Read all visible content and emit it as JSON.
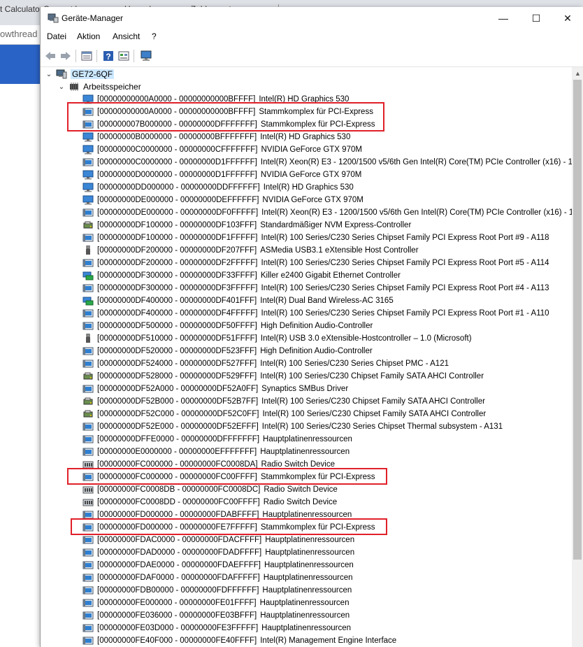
{
  "background": {
    "tabs": [
      "t Calculator",
      "Convert h",
      "Umrechnung von Zahlensyste"
    ],
    "url_fragment": "owthread"
  },
  "window": {
    "title": "Geräte-Manager",
    "controls": {
      "minimize": "—",
      "maximize": "☐",
      "close": "✕"
    }
  },
  "menu": [
    "Datei",
    "Aktion",
    "Ansicht",
    "?"
  ],
  "toolbar": [
    "back-icon",
    "forward-icon",
    "properties-icon",
    "help-icon",
    "show-icon",
    "monitor-icon"
  ],
  "tree": {
    "root": "GE72-6QF",
    "category": "Arbeitsspeicher",
    "items": [
      {
        "range": "[00000000000A0000 - 00000000000BFFFF]",
        "device": "Intel(R) HD Graphics 530",
        "icon": "display"
      },
      {
        "range": "[00000000000A0000 - 00000000000BFFFF]",
        "device": "Stammkomplex für PCI-Express",
        "icon": "device"
      },
      {
        "range": "[000000007B000000 - 00000000DFFFFFFF]",
        "device": "Stammkomplex für PCI-Express",
        "icon": "device"
      },
      {
        "range": "[00000000B0000000 - 00000000BFFFFFFF]",
        "device": "Intel(R) HD Graphics 530",
        "icon": "display"
      },
      {
        "range": "[00000000C0000000 - 00000000CFFFFFFF]",
        "device": "NVIDIA GeForce GTX 970M",
        "icon": "display"
      },
      {
        "range": "[00000000C0000000 - 00000000D1FFFFFF]",
        "device": "Intel(R) Xeon(R) E3 - 1200/1500 v5/6th Gen Intel(R) Core(TM) PCIe Controller (x16) - 190",
        "icon": "device"
      },
      {
        "range": "[00000000D0000000 - 00000000D1FFFFFF]",
        "device": "NVIDIA GeForce GTX 970M",
        "icon": "display"
      },
      {
        "range": "[00000000DD000000 - 00000000DDFFFFFF]",
        "device": "Intel(R) HD Graphics 530",
        "icon": "display"
      },
      {
        "range": "[00000000DE000000 - 00000000DEFFFFFF]",
        "device": "NVIDIA GeForce GTX 970M",
        "icon": "display"
      },
      {
        "range": "[00000000DE000000 - 00000000DF0FFFFF]",
        "device": "Intel(R) Xeon(R) E3 - 1200/1500 v5/6th Gen Intel(R) Core(TM) PCIe Controller (x16) - 190",
        "icon": "device"
      },
      {
        "range": "[00000000DF100000 - 00000000DF103FFF]",
        "device": "Standardmäßiger NVM Express-Controller",
        "icon": "storage"
      },
      {
        "range": "[00000000DF100000 - 00000000DF1FFFFF]",
        "device": "Intel(R) 100 Series/C230 Series Chipset Family PCI Express Root Port #9 - A118",
        "icon": "device"
      },
      {
        "range": "[00000000DF200000 - 00000000DF207FFF]",
        "device": "ASMedia USB3.1 eXtensible Host Controller",
        "icon": "usb"
      },
      {
        "range": "[00000000DF200000 - 00000000DF2FFFFF]",
        "device": "Intel(R) 100 Series/C230 Series Chipset Family PCI Express Root Port #5 - A114",
        "icon": "device"
      },
      {
        "range": "[00000000DF300000 - 00000000DF33FFFF]",
        "device": "Killer e2400 Gigabit Ethernet Controller",
        "icon": "network"
      },
      {
        "range": "[00000000DF300000 - 00000000DF3FFFFF]",
        "device": "Intel(R) 100 Series/C230 Series Chipset Family PCI Express Root Port #4 - A113",
        "icon": "device"
      },
      {
        "range": "[00000000DF400000 - 00000000DF401FFF]",
        "device": "Intel(R) Dual Band Wireless-AC 3165",
        "icon": "network"
      },
      {
        "range": "[00000000DF400000 - 00000000DF4FFFFF]",
        "device": "Intel(R) 100 Series/C230 Series Chipset Family PCI Express Root Port #1 - A110",
        "icon": "device"
      },
      {
        "range": "[00000000DF500000 - 00000000DF50FFFF]",
        "device": "High Definition Audio-Controller",
        "icon": "device"
      },
      {
        "range": "[00000000DF510000 - 00000000DF51FFFF]",
        "device": "Intel(R) USB 3.0 eXtensible-Hostcontroller – 1.0 (Microsoft)",
        "icon": "usb"
      },
      {
        "range": "[00000000DF520000 - 00000000DF523FFF]",
        "device": "High Definition Audio-Controller",
        "icon": "device"
      },
      {
        "range": "[00000000DF524000 - 00000000DF527FFF]",
        "device": "Intel(R) 100 Series/C230 Series Chipset PMC - A121",
        "icon": "device"
      },
      {
        "range": "[00000000DF528000 - 00000000DF529FFF]",
        "device": "Intel(R) 100 Series/C230 Chipset Family SATA AHCI Controller",
        "icon": "storage"
      },
      {
        "range": "[00000000DF52A000 - 00000000DF52A0FF]",
        "device": "Synaptics SMBus Driver",
        "icon": "device"
      },
      {
        "range": "[00000000DF52B000 - 00000000DF52B7FF]",
        "device": "Intel(R) 100 Series/C230 Chipset Family SATA AHCI Controller",
        "icon": "storage"
      },
      {
        "range": "[00000000DF52C000 - 00000000DF52C0FF]",
        "device": "Intel(R) 100 Series/C230 Chipset Family SATA AHCI Controller",
        "icon": "storage"
      },
      {
        "range": "[00000000DF52E000 - 00000000DF52EFFF]",
        "device": "Intel(R) 100 Series/C230 Series Chipset Thermal subsystem - A131",
        "icon": "device"
      },
      {
        "range": "[00000000DFFE0000 - 00000000DFFFFFFF]",
        "device": "Hauptplatinenressourcen",
        "icon": "device"
      },
      {
        "range": "[00000000E0000000 - 00000000EFFFFFFF]",
        "device": "Hauptplatinenressourcen",
        "icon": "device"
      },
      {
        "range": "[00000000FC000000 - 00000000FC0008DA]",
        "device": "Radio Switch Device",
        "icon": "radio"
      },
      {
        "range": "[00000000FC000000 - 00000000FC00FFFF]",
        "device": "Stammkomplex für PCI-Express",
        "icon": "device"
      },
      {
        "range": "[00000000FC0008DB - 00000000FC0008DC]",
        "device": "Radio Switch Device",
        "icon": "radio"
      },
      {
        "range": "[00000000FC0008DD - 00000000FC00FFFF]",
        "device": "Radio Switch Device",
        "icon": "radio"
      },
      {
        "range": "[00000000FD000000 - 00000000FDABFFFF]",
        "device": "Hauptplatinenressourcen",
        "icon": "device"
      },
      {
        "range": "[00000000FD000000 - 00000000FE7FFFFF]",
        "device": "Stammkomplex für PCI-Express",
        "icon": "device"
      },
      {
        "range": "[00000000FDAC0000 - 00000000FDACFFFF]",
        "device": "Hauptplatinenressourcen",
        "icon": "device"
      },
      {
        "range": "[00000000FDAD0000 - 00000000FDADFFFF]",
        "device": "Hauptplatinenressourcen",
        "icon": "device"
      },
      {
        "range": "[00000000FDAE0000 - 00000000FDAEFFFF]",
        "device": "Hauptplatinenressourcen",
        "icon": "device"
      },
      {
        "range": "[00000000FDAF0000 - 00000000FDAFFFFF]",
        "device": "Hauptplatinenressourcen",
        "icon": "device"
      },
      {
        "range": "[00000000FDB00000 - 00000000FDFFFFFF]",
        "device": "Hauptplatinenressourcen",
        "icon": "device"
      },
      {
        "range": "[00000000FE000000 - 00000000FE01FFFF]",
        "device": "Hauptplatinenressourcen",
        "icon": "device"
      },
      {
        "range": "[00000000FE036000 - 00000000FE03BFFF]",
        "device": "Hauptplatinenressourcen",
        "icon": "device"
      },
      {
        "range": "[00000000FE03D000 - 00000000FE3FFFFF]",
        "device": "Hauptplatinenressourcen",
        "icon": "device"
      },
      {
        "range": "[00000000FE40F000 - 00000000FE40FFFF]",
        "device": "Intel(R) Management Engine Interface",
        "icon": "device"
      }
    ]
  },
  "colors": {
    "highlight": "#e0202a",
    "selection": "#cce8ff"
  }
}
